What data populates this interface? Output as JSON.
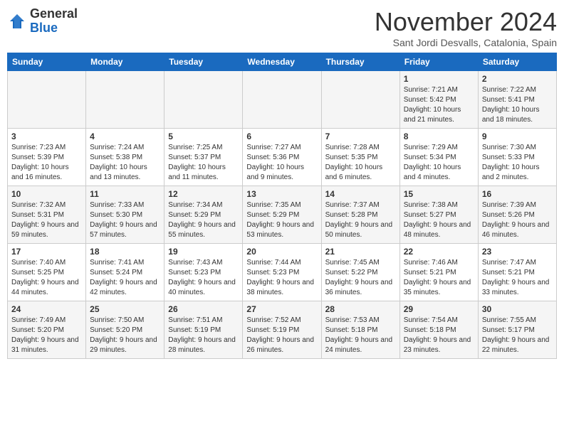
{
  "logo": {
    "general": "General",
    "blue": "Blue"
  },
  "title": "November 2024",
  "subtitle": "Sant Jordi Desvalls, Catalonia, Spain",
  "days_of_week": [
    "Sunday",
    "Monday",
    "Tuesday",
    "Wednesday",
    "Thursday",
    "Friday",
    "Saturday"
  ],
  "weeks": [
    [
      {
        "day": "",
        "info": ""
      },
      {
        "day": "",
        "info": ""
      },
      {
        "day": "",
        "info": ""
      },
      {
        "day": "",
        "info": ""
      },
      {
        "day": "",
        "info": ""
      },
      {
        "day": "1",
        "info": "Sunrise: 7:21 AM\nSunset: 5:42 PM\nDaylight: 10 hours and 21 minutes."
      },
      {
        "day": "2",
        "info": "Sunrise: 7:22 AM\nSunset: 5:41 PM\nDaylight: 10 hours and 18 minutes."
      }
    ],
    [
      {
        "day": "3",
        "info": "Sunrise: 7:23 AM\nSunset: 5:39 PM\nDaylight: 10 hours and 16 minutes."
      },
      {
        "day": "4",
        "info": "Sunrise: 7:24 AM\nSunset: 5:38 PM\nDaylight: 10 hours and 13 minutes."
      },
      {
        "day": "5",
        "info": "Sunrise: 7:25 AM\nSunset: 5:37 PM\nDaylight: 10 hours and 11 minutes."
      },
      {
        "day": "6",
        "info": "Sunrise: 7:27 AM\nSunset: 5:36 PM\nDaylight: 10 hours and 9 minutes."
      },
      {
        "day": "7",
        "info": "Sunrise: 7:28 AM\nSunset: 5:35 PM\nDaylight: 10 hours and 6 minutes."
      },
      {
        "day": "8",
        "info": "Sunrise: 7:29 AM\nSunset: 5:34 PM\nDaylight: 10 hours and 4 minutes."
      },
      {
        "day": "9",
        "info": "Sunrise: 7:30 AM\nSunset: 5:33 PM\nDaylight: 10 hours and 2 minutes."
      }
    ],
    [
      {
        "day": "10",
        "info": "Sunrise: 7:32 AM\nSunset: 5:31 PM\nDaylight: 9 hours and 59 minutes."
      },
      {
        "day": "11",
        "info": "Sunrise: 7:33 AM\nSunset: 5:30 PM\nDaylight: 9 hours and 57 minutes."
      },
      {
        "day": "12",
        "info": "Sunrise: 7:34 AM\nSunset: 5:29 PM\nDaylight: 9 hours and 55 minutes."
      },
      {
        "day": "13",
        "info": "Sunrise: 7:35 AM\nSunset: 5:29 PM\nDaylight: 9 hours and 53 minutes."
      },
      {
        "day": "14",
        "info": "Sunrise: 7:37 AM\nSunset: 5:28 PM\nDaylight: 9 hours and 50 minutes."
      },
      {
        "day": "15",
        "info": "Sunrise: 7:38 AM\nSunset: 5:27 PM\nDaylight: 9 hours and 48 minutes."
      },
      {
        "day": "16",
        "info": "Sunrise: 7:39 AM\nSunset: 5:26 PM\nDaylight: 9 hours and 46 minutes."
      }
    ],
    [
      {
        "day": "17",
        "info": "Sunrise: 7:40 AM\nSunset: 5:25 PM\nDaylight: 9 hours and 44 minutes."
      },
      {
        "day": "18",
        "info": "Sunrise: 7:41 AM\nSunset: 5:24 PM\nDaylight: 9 hours and 42 minutes."
      },
      {
        "day": "19",
        "info": "Sunrise: 7:43 AM\nSunset: 5:23 PM\nDaylight: 9 hours and 40 minutes."
      },
      {
        "day": "20",
        "info": "Sunrise: 7:44 AM\nSunset: 5:23 PM\nDaylight: 9 hours and 38 minutes."
      },
      {
        "day": "21",
        "info": "Sunrise: 7:45 AM\nSunset: 5:22 PM\nDaylight: 9 hours and 36 minutes."
      },
      {
        "day": "22",
        "info": "Sunrise: 7:46 AM\nSunset: 5:21 PM\nDaylight: 9 hours and 35 minutes."
      },
      {
        "day": "23",
        "info": "Sunrise: 7:47 AM\nSunset: 5:21 PM\nDaylight: 9 hours and 33 minutes."
      }
    ],
    [
      {
        "day": "24",
        "info": "Sunrise: 7:49 AM\nSunset: 5:20 PM\nDaylight: 9 hours and 31 minutes."
      },
      {
        "day": "25",
        "info": "Sunrise: 7:50 AM\nSunset: 5:20 PM\nDaylight: 9 hours and 29 minutes."
      },
      {
        "day": "26",
        "info": "Sunrise: 7:51 AM\nSunset: 5:19 PM\nDaylight: 9 hours and 28 minutes."
      },
      {
        "day": "27",
        "info": "Sunrise: 7:52 AM\nSunset: 5:19 PM\nDaylight: 9 hours and 26 minutes."
      },
      {
        "day": "28",
        "info": "Sunrise: 7:53 AM\nSunset: 5:18 PM\nDaylight: 9 hours and 24 minutes."
      },
      {
        "day": "29",
        "info": "Sunrise: 7:54 AM\nSunset: 5:18 PM\nDaylight: 9 hours and 23 minutes."
      },
      {
        "day": "30",
        "info": "Sunrise: 7:55 AM\nSunset: 5:17 PM\nDaylight: 9 hours and 22 minutes."
      }
    ]
  ]
}
